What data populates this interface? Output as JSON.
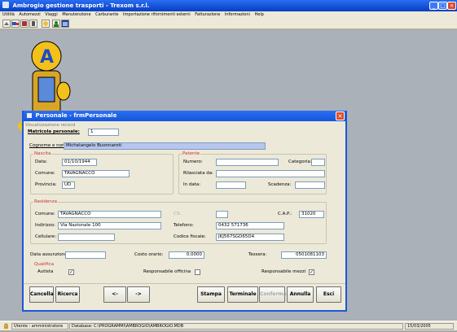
{
  "window": {
    "title": "Ambrogio gestione trasporti - Trexom s.r.l."
  },
  "menu": [
    "Utilità",
    "Automezzi",
    "Viaggi",
    "Manutenzione",
    "Carburante",
    "Importazione rifornimenti esterni",
    "Fatturazione",
    "Informazioni",
    "Help"
  ],
  "status": {
    "user": "Utente : amministratore",
    "database": "Database: C:\\PROGRAMMI\\AMBROGIO\\AMBROGIO.MDB",
    "date": "15/03/2005"
  },
  "form": {
    "title": "Personale - frmPersonale",
    "view_label": "Visualizzazione record",
    "matricola_label": "Matricola personale:",
    "matricola_value": "1",
    "cognome_label": "Cognome e nome:",
    "cognome_value": "Michelangelo Buonnaroti",
    "nascita": {
      "title": "Nascita",
      "data_label": "Data:",
      "data_value": "01/10/1944",
      "comune_label": "Comune:",
      "comune_value": "TAVAGNACCO",
      "provincia_label": "Provincia:",
      "provincia_value": "UD"
    },
    "patente": {
      "title": "Patente",
      "numero_label": "Numero:",
      "numero_value": "",
      "categoria_label": "Categoria:",
      "categoria_value": "",
      "rilasciata_label": "Rilasciata da:",
      "rilasciata_value": "",
      "indata_label": "In data:",
      "indata_value": "",
      "scadenza_label": "Scadenza:",
      "scadenza_value": ""
    },
    "residenza": {
      "title": "Residenza",
      "comune_label": "Comune:",
      "comune_value": "TAVAGNACCO",
      "cs_label": "CS:",
      "cs_value": "",
      "cap_label": "C.A.P.:",
      "cap_value": "31020",
      "indirizzo_label": "Indirizzo:",
      "indirizzo_value": "Via Nazionale 100",
      "telefono_label": "Telefono:",
      "telefono_value": "0432 571736",
      "cellulare_label": "Cellulare:",
      "cellulare_value": "",
      "codfisc_label": "Codice fiscale:",
      "codfisc_value": "JKJ567SGD65D4"
    },
    "assunzione_label": "Data assunzione:",
    "assunzione_value": "",
    "costo_label": "Costo orario:",
    "costo_value": "0,0000",
    "tessera_label": "Tessera:",
    "tessera_value": "0501081103",
    "qualifica": {
      "title": "Qualifica",
      "autista_label": "Autista",
      "autista_checked": "✓",
      "officina_label": "Responsabile officina",
      "officina_checked": "",
      "mezzi_label": "Responsabile mezzi",
      "mezzi_checked": "✓"
    },
    "buttons": {
      "cancella": "Cancella",
      "ricerca": "Ricerca",
      "prev": "<-",
      "next": "->",
      "stampa": "Stampa",
      "terminale": "Terminale",
      "conferma": "Conferma",
      "annulla": "Annulla",
      "esci": "Esci"
    }
  }
}
